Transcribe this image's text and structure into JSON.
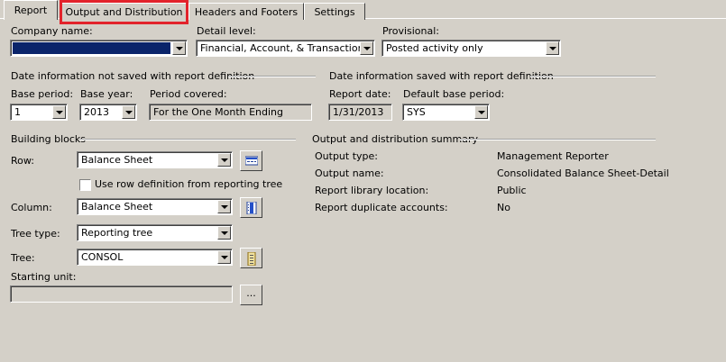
{
  "tabs": [
    {
      "label": "Report"
    },
    {
      "label": "Output and Distribution"
    },
    {
      "label": "Headers and Footers"
    },
    {
      "label": "Settings"
    }
  ],
  "top": {
    "company_label": "Company name:",
    "detail_label": "Detail level:",
    "detail_value": "Financial, Account, & Transaction",
    "provisional_label": "Provisional:",
    "provisional_value": "Posted activity only"
  },
  "date_not_saved": {
    "heading": "Date information not saved with report definition",
    "base_period_label": "Base period:",
    "base_period_value": "1",
    "base_year_label": "Base year:",
    "base_year_value": "2013",
    "period_covered_label": "Period covered:",
    "period_covered_value": "For the One Month Ending"
  },
  "date_saved": {
    "heading": "Date information saved with report definition",
    "report_date_label": "Report date:",
    "report_date_value": "1/31/2013",
    "default_base_period_label": "Default base period:",
    "default_base_period_value": "SYS"
  },
  "building_blocks": {
    "heading": "Building blocks",
    "row_label": "Row:",
    "row_value": "Balance Sheet",
    "use_row_def_label": "Use row definition from reporting tree",
    "column_label": "Column:",
    "column_value": "Balance Sheet",
    "tree_type_label": "Tree type:",
    "tree_type_value": "Reporting tree",
    "tree_label": "Tree:",
    "tree_value": "CONSOL",
    "starting_unit_label": "Starting unit:",
    "browse_label": "..."
  },
  "summary": {
    "heading": "Output and distribution summary",
    "rows": [
      {
        "label": "Output type:",
        "value": "Management Reporter"
      },
      {
        "label": "Output name:",
        "value": "Consolidated Balance Sheet-Detail"
      },
      {
        "label": "Report library location:",
        "value": "Public"
      },
      {
        "label": "Report duplicate accounts:",
        "value": "No"
      }
    ]
  }
}
